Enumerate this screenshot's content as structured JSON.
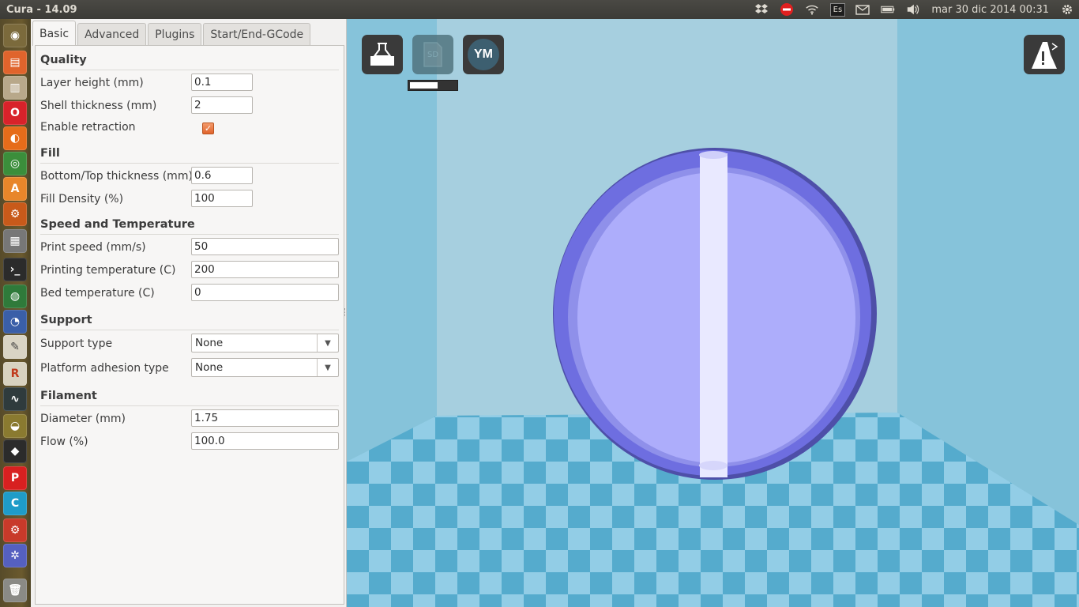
{
  "topbar": {
    "title": "Cura - 14.09",
    "keyboard_layout": "Es",
    "clock": "mar 30 dic 2014 00:31",
    "tray_icons": [
      "dropbox-icon",
      "stop-icon",
      "wifi-icon",
      "keyboard-icon",
      "mail-icon",
      "battery-icon",
      "volume-icon",
      "gear-icon"
    ]
  },
  "launcher": {
    "items": [
      "ubuntu-dash",
      "files",
      "archive-manager",
      "opera",
      "firefox",
      "chromium",
      "software-center",
      "system-settings",
      "calculator",
      "terminal",
      "web-app",
      "eclipse",
      "text-editor",
      "r-app",
      "system-monitor",
      "blender",
      "inkscape",
      "pdf-app",
      "cura",
      "tweak-tool",
      "molecule-app",
      "trash"
    ]
  },
  "tabs": [
    "Basic",
    "Advanced",
    "Plugins",
    "Start/End-GCode"
  ],
  "active_tab": "Basic",
  "quality": {
    "title": "Quality",
    "layer_height_label": "Layer height (mm)",
    "layer_height": "0.1",
    "shell_thickness_label": "Shell thickness (mm)",
    "shell_thickness": "2",
    "retraction_label": "Enable retraction",
    "retraction_checked": true
  },
  "fill": {
    "title": "Fill",
    "bottom_top_label": "Bottom/Top thickness (mm)",
    "bottom_top": "0.6",
    "density_label": "Fill Density (%)",
    "density": "100"
  },
  "speed": {
    "title": "Speed and Temperature",
    "print_speed_label": "Print speed (mm/s)",
    "print_speed": "50",
    "print_temp_label": "Printing temperature (C)",
    "print_temp": "200",
    "bed_temp_label": "Bed temperature (C)",
    "bed_temp": "0"
  },
  "support": {
    "title": "Support",
    "type_label": "Support type",
    "type": "None",
    "adhesion_label": "Platform adhesion type",
    "adhesion": "None"
  },
  "filament": {
    "title": "Filament",
    "diameter_label": "Diameter (mm)",
    "diameter": "1.75",
    "flow_label": "Flow (%)",
    "flow": "100.0"
  },
  "viewport": {
    "sd_label": "SD",
    "ym_label": "YM",
    "progress": 0.6,
    "colors": {
      "model_face": "#adadfb",
      "model_edge": "#6e6ee0",
      "bed_light": "#92cde6",
      "bed_dark": "#4fa7c9"
    }
  }
}
